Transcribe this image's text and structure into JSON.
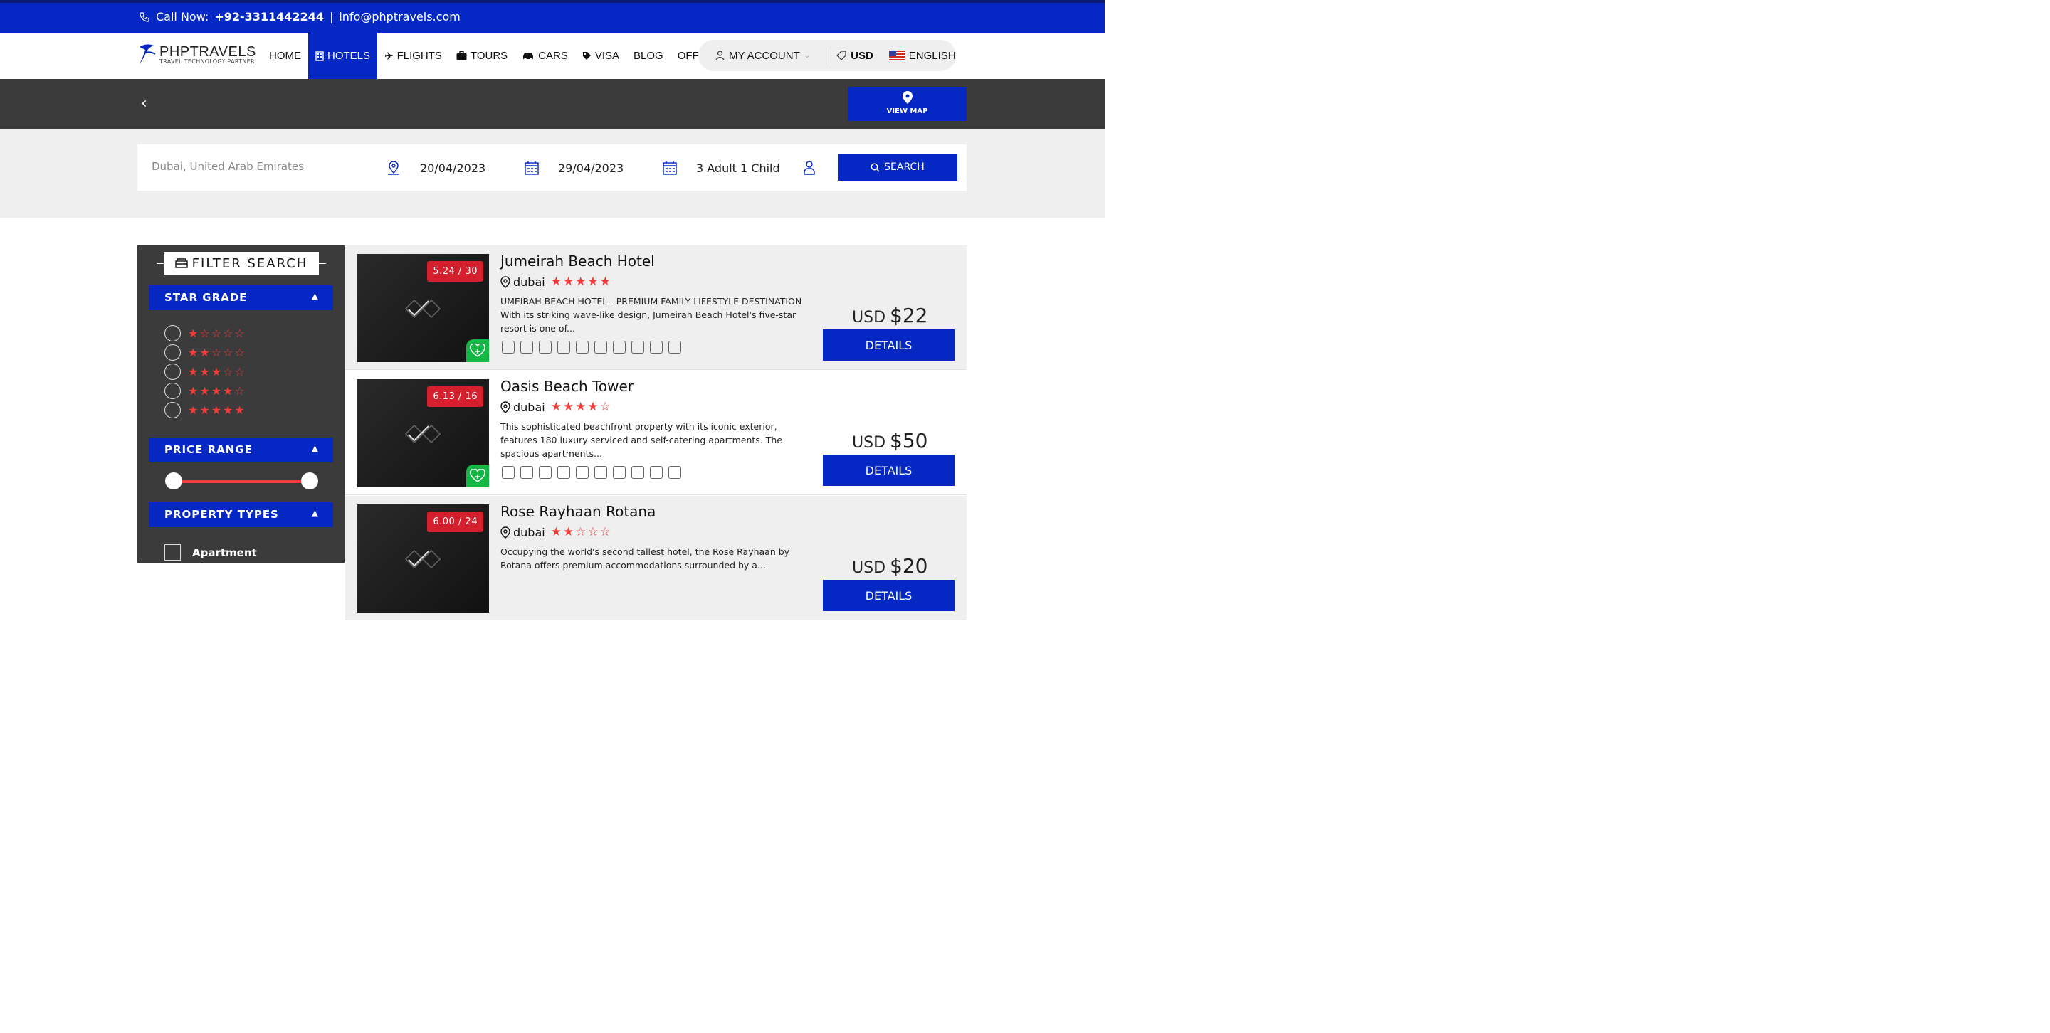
{
  "topbar": {
    "call_label": "Call Now:",
    "phone": "+92-3311442244",
    "divider": "|",
    "email": "info@phptravels.com"
  },
  "logo": {
    "brand": "PHPTRAVELS",
    "tagline": "TRAVEL TECHNOLOGY PARTNER"
  },
  "nav": {
    "items": [
      "HOME",
      "HOTELS",
      "FLIGHTS",
      "TOURS",
      "CARS",
      "VISA",
      "BLOG",
      "OFFERS"
    ],
    "active": "HOTELS",
    "account": "MY ACCOUNT",
    "currency": "USD",
    "language": "ENGLISH"
  },
  "header": {
    "view_map": "VIEW MAP"
  },
  "search": {
    "destination": "Dubai, United Arab Emirates",
    "checkin": "20/04/2023",
    "checkout": "29/04/2023",
    "guests": "3 Adult 1 Child",
    "button": "SEARCH"
  },
  "filter": {
    "title": "FILTER SEARCH",
    "star_grade": "STAR GRADE",
    "star_options": [
      "★☆☆☆☆",
      "★★☆☆☆",
      "★★★☆☆",
      "★★★★☆",
      "★★★★★"
    ],
    "price_range": "PRICE RANGE",
    "property_types": "PROPERTY TYPES",
    "property_options": [
      "Apartment"
    ]
  },
  "hotels": [
    {
      "name": "Jumeirah Beach Hotel",
      "score": "5.24 / 30",
      "location": "dubai",
      "stars": "★★★★★",
      "description": "UMEIRAH BEACH HOTEL - PREMIUM FAMILY LIFESTYLE DESTINATION With its striking wave-like design, Jumeirah Beach Hotel's five-star resort is one of...",
      "currency": "USD",
      "price": "$22",
      "details": "DETAILS"
    },
    {
      "name": "Oasis Beach Tower",
      "score": "6.13 / 16",
      "location": "dubai",
      "stars": "★★★★☆",
      "description": "This sophisticated beachfront property with its iconic exterior, features 180 luxury serviced and self-catering apartments. The spacious apartments...",
      "currency": "USD",
      "price": "$50",
      "details": "DETAILS"
    },
    {
      "name": "Rose Rayhaan Rotana",
      "score": "6.00 / 24",
      "location": "dubai",
      "stars": "★★☆☆☆",
      "description": "Occupying the world's second tallest hotel, the Rose Rayhaan by Rotana offers premium accommodations surrounded by a...",
      "currency": "USD",
      "price": "$20",
      "details": "DETAILS"
    }
  ],
  "colors": {
    "primary": "#0528c5",
    "dark": "#3b3b3b",
    "star": "#f23b3b",
    "score": "#d61f2c",
    "fav": "#12b844"
  }
}
